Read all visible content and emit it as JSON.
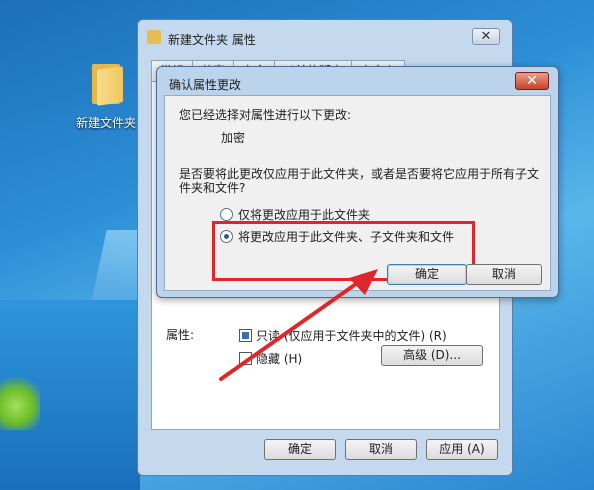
{
  "desktop": {
    "icon_label": "新建文件夹"
  },
  "properties_window": {
    "title": "新建文件夹 属性",
    "close_glyph": "✕",
    "tabs": [
      "常规",
      "共享",
      "安全",
      "以前的版本",
      "自定义"
    ],
    "attributes_label": "属性:",
    "readonly_label": "只读 (仅应用于文件夹中的文件) (R)",
    "hidden_label": "隐藏 (H)",
    "advanced_button": "高级 (D)...",
    "ok_button": "确定",
    "cancel_button": "取消",
    "apply_button": "应用 (A)"
  },
  "confirm_dialog": {
    "title": "确认属性更改",
    "close_glyph": "✕",
    "intro": "您已经选择对属性进行以下更改:",
    "change": "加密",
    "question_line1": "是否要将此更改仅应用于此文件夹，或者是否要将它应用于所有子文",
    "question_line2": "件夹和文件?",
    "option_this_folder": "仅将更改应用于此文件夹",
    "option_all": "将更改应用于此文件夹、子文件夹和文件",
    "selected_option": "option_all",
    "ok_button": "确定",
    "cancel_button": "取消"
  },
  "colors": {
    "highlight": "#e0262d",
    "arrow": "#e0262d",
    "close_button": "#c84228"
  }
}
